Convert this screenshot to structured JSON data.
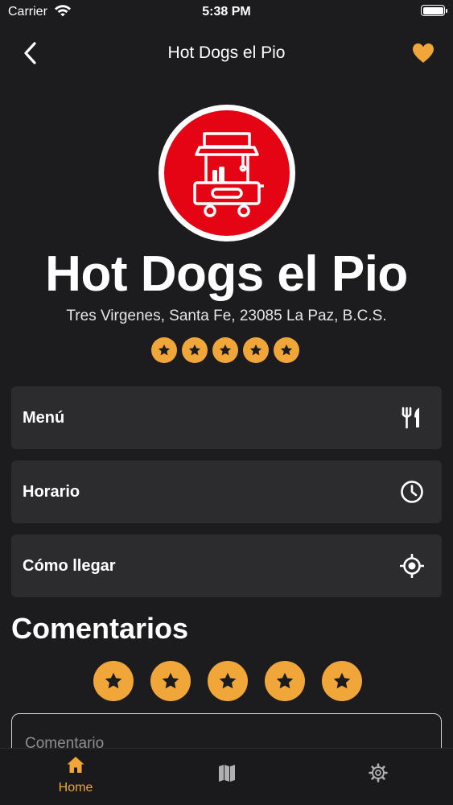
{
  "status_bar": {
    "carrier": "Carrier",
    "time": "5:38 PM"
  },
  "nav": {
    "title": "Hot Dogs el Pio",
    "back_icon": "chevron-left-icon",
    "favorite_icon": "heart-icon"
  },
  "place": {
    "name": "Hot Dogs el Pio",
    "address": "Tres Virgenes, Santa Fe, 23085 La Paz, B.C.S.",
    "rating": 5,
    "rating_max": 5
  },
  "options": [
    {
      "label": "Menú",
      "icon": "fork-knife-icon"
    },
    {
      "label": "Horario",
      "icon": "clock-icon"
    },
    {
      "label": "Cómo llegar",
      "icon": "location-target-icon"
    }
  ],
  "comments": {
    "title": "Comentarios",
    "rating": 5,
    "rating_max": 5,
    "input_placeholder": "Comentario"
  },
  "tab_bar": [
    {
      "label": "Home",
      "icon": "home-icon",
      "active": true
    },
    {
      "label": "",
      "icon": "map-icon",
      "active": false
    },
    {
      "label": "",
      "icon": "gear-icon",
      "active": false
    }
  ],
  "colors": {
    "accent": "#f0a638",
    "background": "#1c1c1e",
    "card": "#2c2c2e",
    "logo_red": "#e40414"
  }
}
